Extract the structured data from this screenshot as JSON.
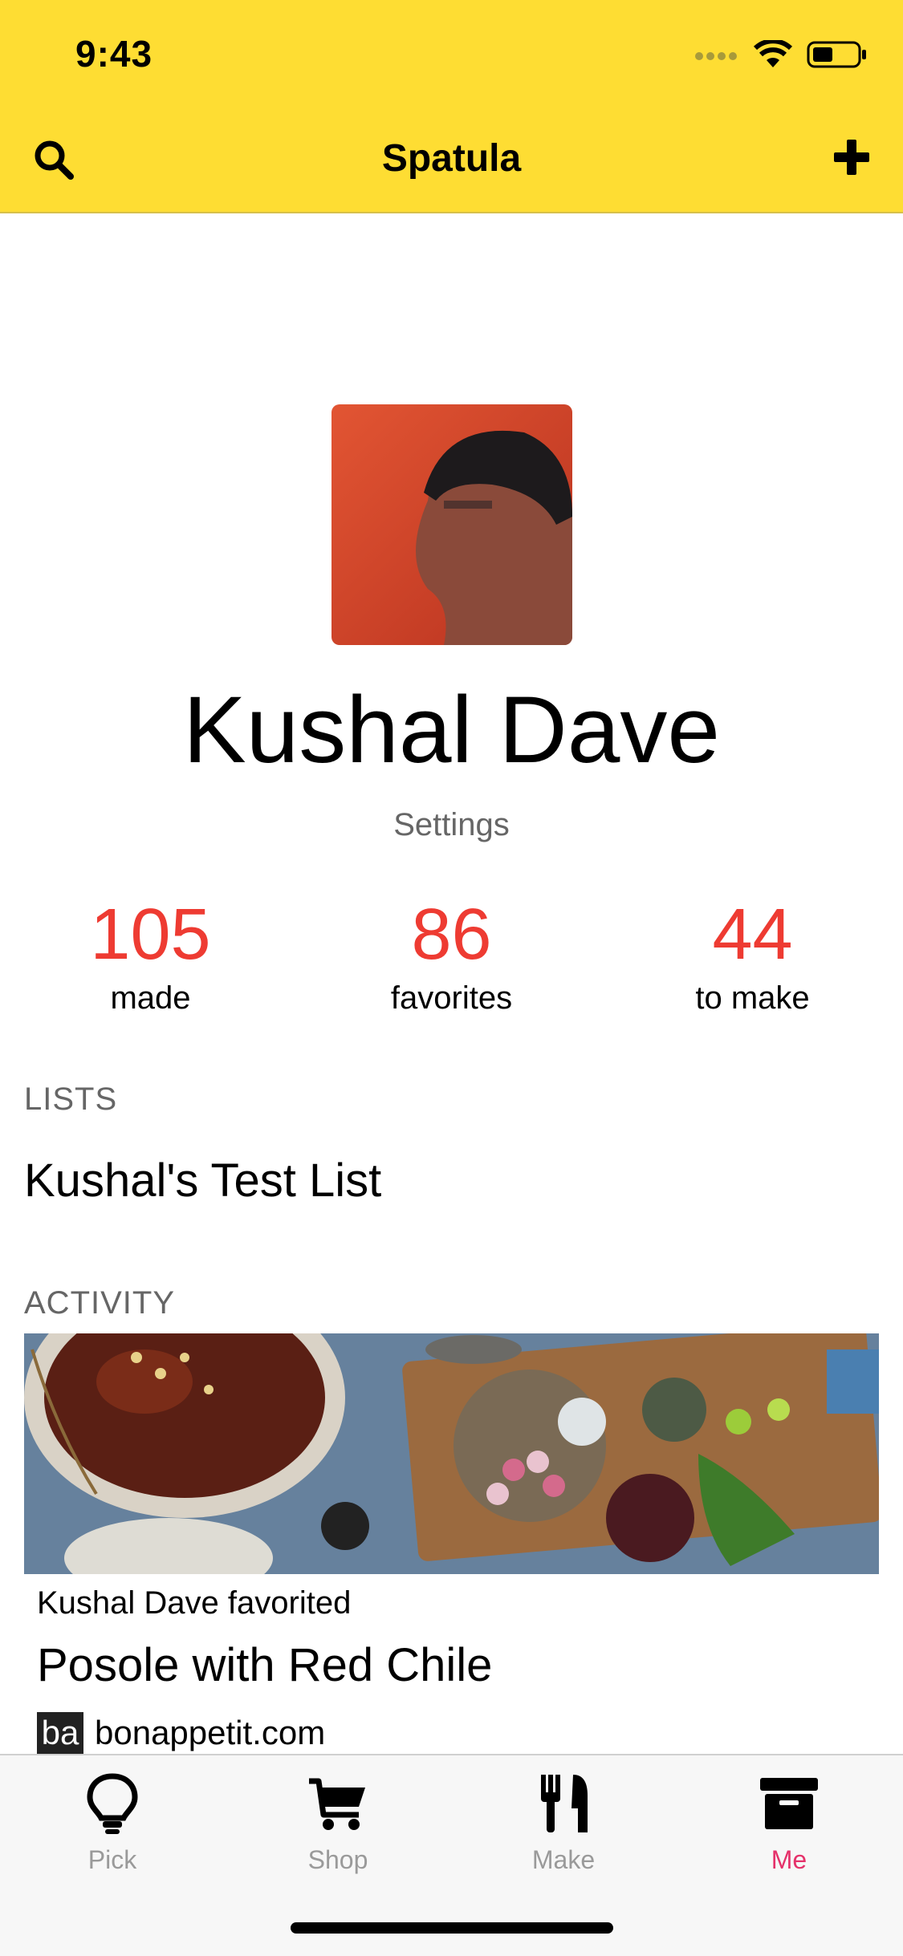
{
  "status_bar": {
    "time": "9:43"
  },
  "nav": {
    "title": "Spatula",
    "search_icon": "search-icon",
    "add_icon": "plus-icon"
  },
  "profile": {
    "name": "Kushal Dave",
    "settings_label": "Settings"
  },
  "stats": [
    {
      "value": "105",
      "label": "made"
    },
    {
      "value": "86",
      "label": "favorites"
    },
    {
      "value": "44",
      "label": "to make"
    }
  ],
  "lists": {
    "header": "LISTS",
    "items": [
      "Kushal's Test List"
    ]
  },
  "activity": {
    "header": "ACTIVITY",
    "items": [
      {
        "actor_text": "Kushal Dave favorited",
        "recipe_title": "Posole with Red Chile",
        "source_badge": "ba",
        "source": "bonappetit.com"
      }
    ]
  },
  "tabbar": {
    "tabs": [
      {
        "label": "Pick",
        "icon": "lightbulb-icon"
      },
      {
        "label": "Shop",
        "icon": "cart-icon"
      },
      {
        "label": "Make",
        "icon": "fork-knife-icon"
      },
      {
        "label": "Me",
        "icon": "archive-box-icon"
      }
    ],
    "active_index": 3
  },
  "colors": {
    "brand_yellow": "#FEDD33",
    "stat_red": "#EE3B32",
    "active_tab": "#E5326B"
  }
}
